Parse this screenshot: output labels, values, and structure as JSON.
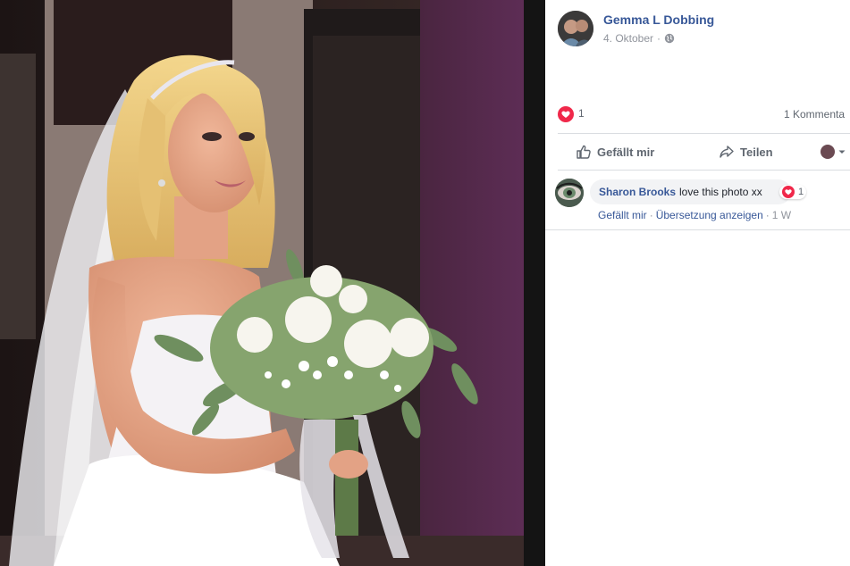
{
  "photo": {
    "description_icon": "bridal-photo"
  },
  "post": {
    "author_name": "Gemma L Dobbing",
    "date": "4. Oktober",
    "date_separator": "·",
    "privacy_icon": "globe-icon",
    "reactions": {
      "icon": "love-reaction-icon",
      "count": "1"
    },
    "comment_count_label": "1 Kommenta"
  },
  "actions": {
    "like_label": "Gefällt mir",
    "share_label": "Teilen"
  },
  "comment": {
    "author": "Sharon Brooks",
    "text": "love this photo xx",
    "reaction_count": "1",
    "like_label": "Gefällt mir",
    "separator": "·",
    "translate_label": "Übersetzung anzeigen",
    "time_label": "1 W"
  },
  "colors": {
    "link_blue": "#385898",
    "love_red": "#f0284a",
    "meta_gray": "#90949c",
    "bubble_gray": "#f2f3f5"
  }
}
